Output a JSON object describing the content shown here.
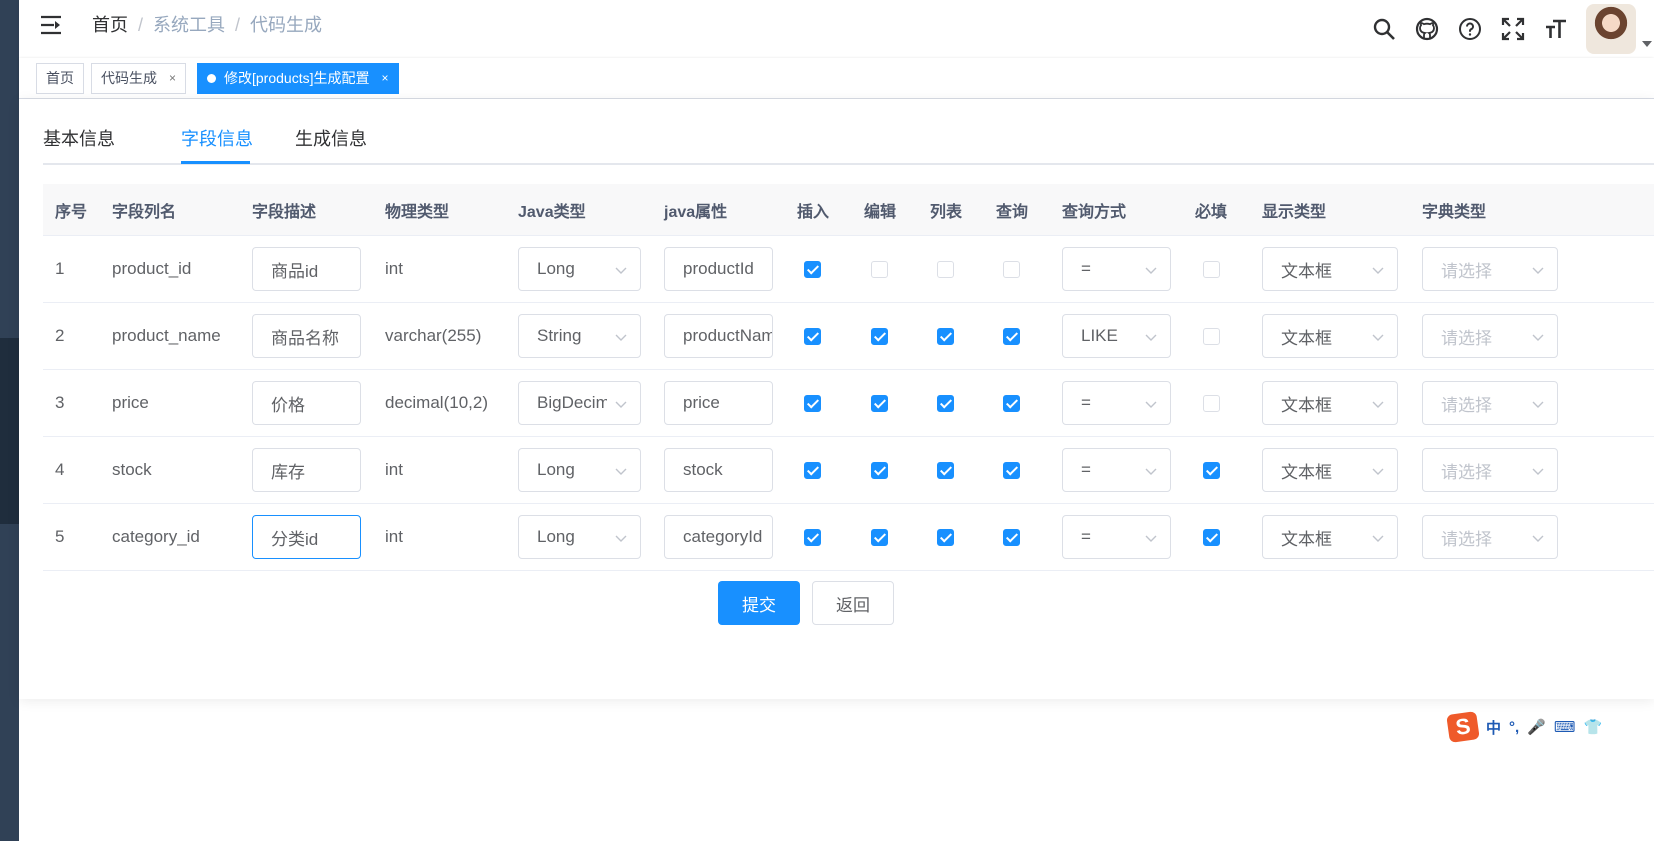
{
  "breadcrumb": [
    "首页",
    "系统工具",
    "代码生成"
  ],
  "header_icons": [
    "search-icon",
    "github-icon",
    "question-icon",
    "fullscreen-icon",
    "font-size-icon"
  ],
  "tags": [
    {
      "label": "首页"
    },
    {
      "label": "代码生成",
      "close": "×"
    },
    {
      "label": "修改[products]生成配置",
      "close": "×",
      "active": true
    }
  ],
  "tabs": [
    "基本信息",
    "字段信息",
    "生成信息"
  ],
  "active_tab": "字段信息",
  "table": {
    "headers": [
      "序号",
      "字段列名",
      "字段描述",
      "物理类型",
      "Java类型",
      "java属性",
      "插入",
      "编辑",
      "列表",
      "查询",
      "查询方式",
      "必填",
      "显示类型",
      "字典类型"
    ],
    "rows": [
      {
        "no": "1",
        "column": "product_id",
        "desc": "商品id",
        "phys": "int",
        "java_type": "Long",
        "java_field": "productId",
        "insert": true,
        "edit": false,
        "list": false,
        "query": false,
        "query_type": "=",
        "required": false,
        "html_type": "文本框",
        "dict": "请选择"
      },
      {
        "no": "2",
        "column": "product_name",
        "desc": "商品名称",
        "phys": "varchar(255)",
        "java_type": "String",
        "java_field": "productName",
        "insert": true,
        "edit": true,
        "list": true,
        "query": true,
        "query_type": "LIKE",
        "required": false,
        "html_type": "文本框",
        "dict": "请选择"
      },
      {
        "no": "3",
        "column": "price",
        "desc": "价格",
        "phys": "decimal(10,2)",
        "java_type": "BigDecimal",
        "java_field": "price",
        "insert": true,
        "edit": true,
        "list": true,
        "query": true,
        "query_type": "=",
        "required": false,
        "html_type": "文本框",
        "dict": "请选择"
      },
      {
        "no": "4",
        "column": "stock",
        "desc": "库存",
        "phys": "int",
        "java_type": "Long",
        "java_field": "stock",
        "insert": true,
        "edit": true,
        "list": true,
        "query": true,
        "query_type": "=",
        "required": true,
        "html_type": "文本框",
        "dict": "请选择"
      },
      {
        "no": "5",
        "column": "category_id",
        "desc": "分类id",
        "phys": "int",
        "java_type": "Long",
        "java_field": "categoryId",
        "insert": true,
        "edit": true,
        "list": true,
        "query": true,
        "query_type": "=",
        "required": true,
        "html_type": "文本框",
        "dict": "请选择",
        "focused": true
      }
    ]
  },
  "buttons": {
    "submit": "提交",
    "back": "返回"
  },
  "ime_toolbar": {
    "logo": "S",
    "items": [
      "中",
      "°,",
      "🎤",
      "⌨",
      "👕"
    ]
  },
  "colors": {
    "primary": "#1890ff",
    "sidebar": "#304156"
  }
}
